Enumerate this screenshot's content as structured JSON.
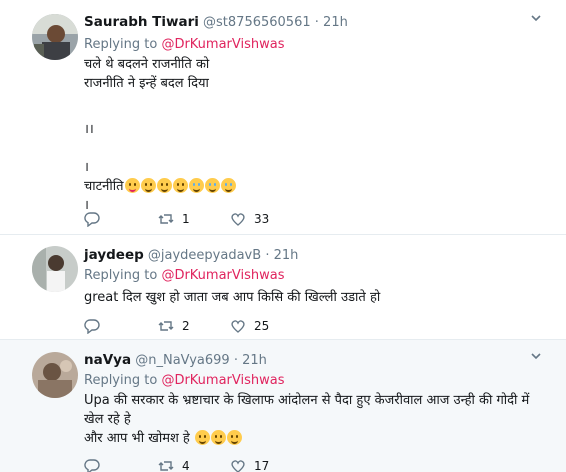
{
  "tweets": [
    {
      "name": "Saurabh Tiwari",
      "handle": "@st8756560561",
      "time": "21h",
      "replying_prefix": "Replying to",
      "replying_to": "@DrKumarVishwas",
      "lines": [
        "चले थे बदलने राजनीति को",
        "राजनीति ने इन्हें बदल दिया",
        "",
        "।।",
        "",
        "।",
        "चाटनीति",
        "।"
      ],
      "emoji_set": [
        "tongue",
        "smile",
        "smile",
        "smile",
        "cry",
        "cry",
        "cry"
      ],
      "reply_count": "",
      "retweet_count": "1",
      "like_count": "33"
    },
    {
      "name": "jaydeep",
      "handle": "@jaydeepyadavB",
      "time": "21h",
      "replying_prefix": "Replying to",
      "replying_to": "@DrKumarVishwas",
      "lines": [
        "great दिल खुश हो जाता जब आप किसि की खिल्ली उडाते हो"
      ],
      "reply_count": "",
      "retweet_count": "2",
      "like_count": "25"
    },
    {
      "name": "naVya",
      "handle": "@n_NaVya699",
      "time": "21h",
      "replying_prefix": "Replying to",
      "replying_to": "@DrKumarVishwas",
      "lines": [
        "Upa की सरकार के भ्रष्टाचार के खिलाफ आंदोलन से पैदा हुए केजरीवाल आज उन्ही की गोदी में",
        "खेल रहे हे",
        "और आप भी खोमश हे"
      ],
      "emoji_set": [
        "smile",
        "smile",
        "smile"
      ],
      "reply_count": "",
      "retweet_count": "4",
      "like_count": "17"
    }
  ],
  "icons": {
    "reply": "reply-icon",
    "retweet": "retweet-icon",
    "like": "heart-icon",
    "caret": "chevron-down-icon"
  },
  "colors": {
    "mention": "#e0245e",
    "muted": "#657786",
    "highlight_bg": "#f5f8fa"
  }
}
